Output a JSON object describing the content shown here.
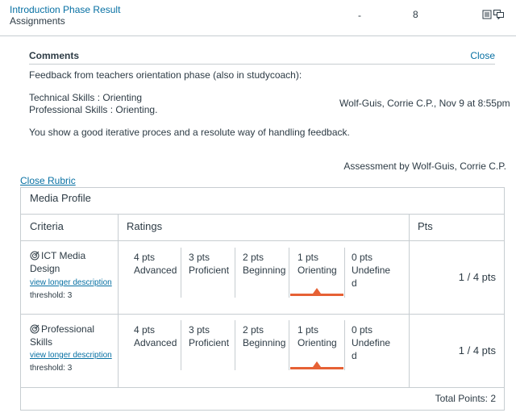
{
  "assignment": {
    "title": "Introduction Phase Result",
    "subtitle": "Assignments",
    "dash": "-",
    "score": "8",
    "icons": [
      "rubric-icon",
      "comments-icon"
    ]
  },
  "comments": {
    "header": "Comments",
    "close_label": "Close",
    "line1": "Feedback from teachers orientation phase (also in studycoach):",
    "line2": "Technical Skills : Orienting",
    "line3": "Professional Skills : Orienting.",
    "line4": "You show a good iterative proces and a resolute way of handling feedback.",
    "author": "Wolf-Guis, Corrie C.P., Nov 9 at 8:55pm"
  },
  "assessment_by": "Assessment by Wolf-Guis, Corrie C.P.",
  "close_rubric_label": "Close Rubric",
  "rubric": {
    "title": "Media Profile",
    "headers": {
      "criteria": "Criteria",
      "ratings": "Ratings",
      "pts": "Pts"
    },
    "criteria": [
      {
        "name_line1": "ICT Media",
        "name_line2": "Design",
        "link": "view longer description",
        "threshold": "threshold: 3",
        "ratings": [
          {
            "pts": "4 pts",
            "label": "Advanced"
          },
          {
            "pts": "3 pts",
            "label": "Proficient"
          },
          {
            "pts": "2 pts",
            "label": "Beginning"
          },
          {
            "pts": "1 pts",
            "label": "Orienting"
          },
          {
            "pts": "0 pts",
            "label1": "Undefine",
            "label2": "d"
          }
        ],
        "selected_index": 3,
        "score": "1 / 4 pts"
      },
      {
        "name_line1": "Professional",
        "name_line2": "Skills",
        "link": "view longer description",
        "threshold": "threshold: 3",
        "ratings": [
          {
            "pts": "4 pts",
            "label": "Advanced"
          },
          {
            "pts": "3 pts",
            "label": "Proficient"
          },
          {
            "pts": "2 pts",
            "label": "Beginning"
          },
          {
            "pts": "1 pts",
            "label": "Orienting"
          },
          {
            "pts": "0 pts",
            "label1": "Undefine",
            "label2": "d"
          }
        ],
        "selected_index": 3,
        "score": "1 / 4 pts"
      }
    ],
    "total": "Total Points: 2"
  },
  "colors": {
    "link": "#0770a3",
    "selected": "#e66135",
    "border": "#c7cdd1",
    "text": "#2d3b45"
  }
}
